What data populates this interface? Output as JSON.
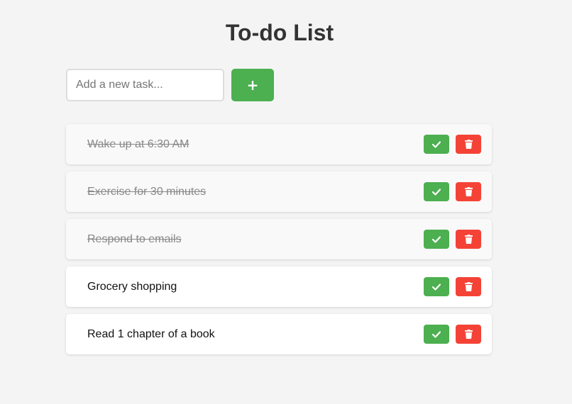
{
  "header": {
    "title": "To-do List"
  },
  "add_form": {
    "placeholder": "Add a new task...",
    "value": "",
    "add_button_label": "+"
  },
  "tasks": [
    {
      "text": "Wake up at 6:30 AM",
      "completed": true
    },
    {
      "text": "Exercise for 30 minutes",
      "completed": true
    },
    {
      "text": "Respond to emails",
      "completed": true
    },
    {
      "text": "Grocery shopping",
      "completed": false
    },
    {
      "text": "Read 1 chapter of a book",
      "completed": false
    }
  ],
  "icons": {
    "complete": "check-icon",
    "delete": "trash-icon"
  },
  "colors": {
    "background": "#f4f4f4",
    "primary": "#4caf50",
    "danger": "#f44336",
    "title": "#333333",
    "completed_text": "#888888"
  }
}
